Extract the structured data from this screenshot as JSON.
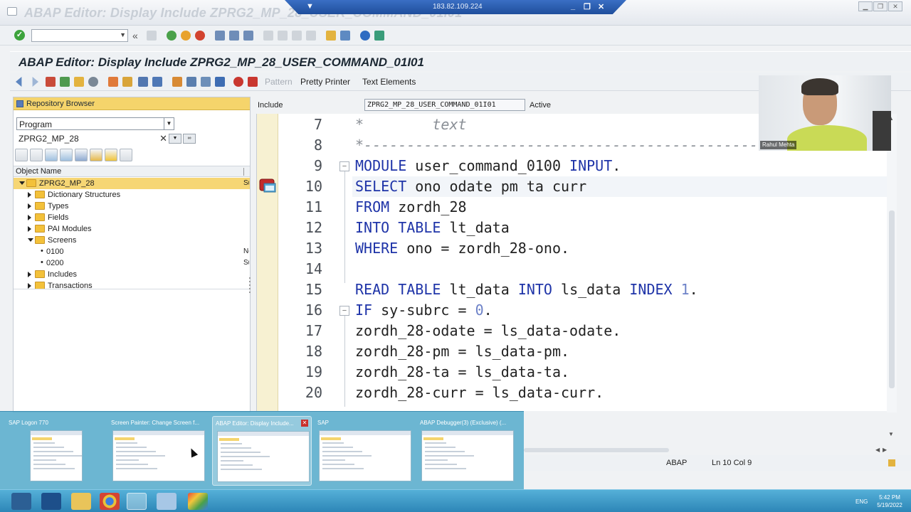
{
  "window": {
    "title": "ABAP Editor: Display Include ZPRG2_MP_28_USER_COMMAND_01I01",
    "remote_host": "183.82.109.224"
  },
  "screen": {
    "title": "ABAP Editor: Display Include ZPRG2_MP_28_USER_COMMAND_01I01"
  },
  "app_toolbar": {
    "pattern_label": "Pattern",
    "pretty_printer_label": "Pretty Printer",
    "text_elements_label": "Text Elements"
  },
  "repository_browser": {
    "header": "Repository Browser",
    "object_type": "Program",
    "object_name": "ZPRG2_MP_28",
    "column_header": "Object Name",
    "tree": [
      {
        "label": "ZPRG2_MP_28",
        "level": 0,
        "expanded": true,
        "folder": true,
        "selected": true,
        "extra": "Su"
      },
      {
        "label": "Dictionary Structures",
        "level": 1,
        "expanded": false,
        "folder": true
      },
      {
        "label": "Types",
        "level": 1,
        "expanded": false,
        "folder": true
      },
      {
        "label": "Fields",
        "level": 1,
        "expanded": false,
        "folder": true
      },
      {
        "label": "PAI Modules",
        "level": 1,
        "expanded": false,
        "folder": true
      },
      {
        "label": "Screens",
        "level": 1,
        "expanded": true,
        "folder": true
      },
      {
        "label": "0100",
        "level": 2,
        "leaf": true,
        "extra": "Ne"
      },
      {
        "label": "0200",
        "level": 2,
        "leaf": true,
        "extra": "Su"
      },
      {
        "label": "Includes",
        "level": 1,
        "expanded": false,
        "folder": true
      },
      {
        "label": "Transactions",
        "level": 1,
        "expanded": false,
        "folder": true
      }
    ]
  },
  "include_bar": {
    "label": "Include",
    "program": "ZPRG2_MP_28_USER_COMMAND_01I01",
    "status": "Active"
  },
  "editor": {
    "lines": [
      {
        "no": "7",
        "text": "*        text",
        "type": "comment"
      },
      {
        "no": "8",
        "text": "*----------------------------------------------------------------------",
        "type": "comment"
      },
      {
        "no": "9",
        "text": "MODULE user_command_0100 INPUT.",
        "fold": true
      },
      {
        "no": "10",
        "text": "SELECT ono odate pm ta curr",
        "cursor": true
      },
      {
        "no": "11",
        "text": "FROM zordh_28"
      },
      {
        "no": "12",
        "text": "INTO TABLE lt_data"
      },
      {
        "no": "13",
        "text": "WHERE ono = zordh_28-ono."
      },
      {
        "no": "14",
        "text": ""
      },
      {
        "no": "15",
        "text": "READ TABLE lt_data INTO ls_data INDEX 1."
      },
      {
        "no": "16",
        "text": "IF sy-subrc = 0.",
        "fold": true
      },
      {
        "no": "17",
        "text": "zordh_28-odate = ls_data-odate."
      },
      {
        "no": "18",
        "text": "zordh_28-pm = ls_data-pm."
      },
      {
        "no": "19",
        "text": "zordh_28-ta = ls_data-ta."
      },
      {
        "no": "20",
        "text": "zordh_28-curr = ls_data-curr."
      }
    ],
    "keywords": [
      "MODULE",
      "INPUT",
      "SELECT",
      "FROM",
      "INTO",
      "TABLE",
      "WHERE",
      "READ",
      "INDEX",
      "IF"
    ],
    "colors": {
      "keyword": "#1f34a8",
      "number": "#6d82c8",
      "comment": "#8a8f96"
    }
  },
  "status_bar": {
    "language": "ABAP",
    "position": "Ln  10 Col  9"
  },
  "webcam": {
    "name": "Rahul Mehta"
  },
  "task_thumbnails": [
    {
      "title": "SAP Logon 770",
      "active": false
    },
    {
      "title": "Screen Painter: Change Screen f...",
      "active": false
    },
    {
      "title": "ABAP Editor: Display Include...",
      "active": true
    },
    {
      "title": "SAP",
      "active": false
    },
    {
      "title": "ABAP Debugger(3)  (Exclusive) (...",
      "active": false
    }
  ],
  "taskbar": {
    "language": "ENG",
    "time": "5:42 PM",
    "date": "5/19/2022",
    "icons": [
      "start-icon",
      "powershell-icon",
      "file-explorer-icon",
      "chrome-icon",
      "sap-logon-icon",
      "app-icon",
      "paint-icon"
    ]
  }
}
